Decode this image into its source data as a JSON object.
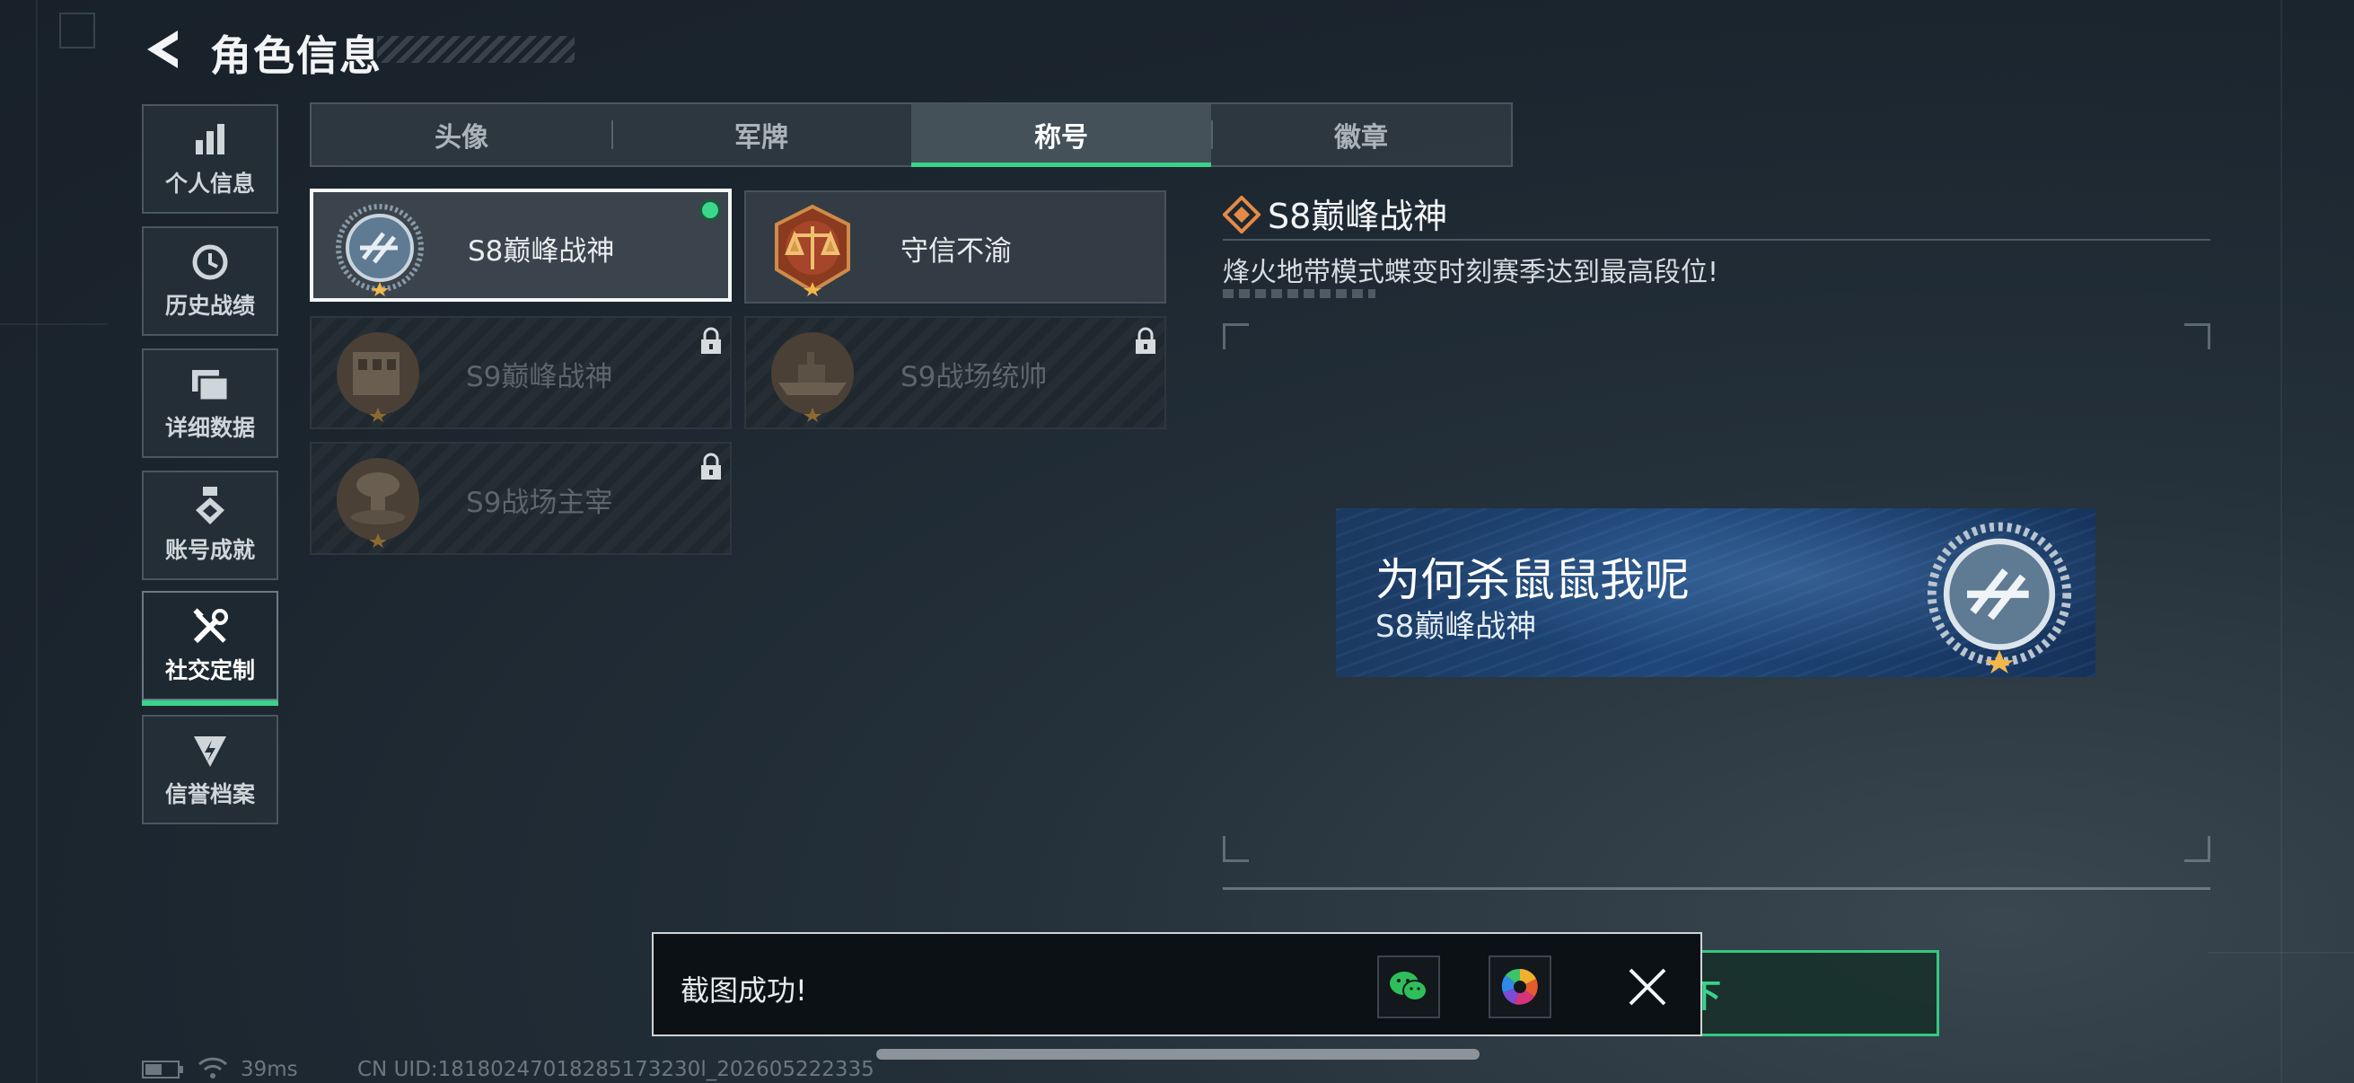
{
  "header": {
    "title": "角色信息"
  },
  "sidebar": {
    "items": [
      {
        "label": "个人信息",
        "icon": "bar-chart-icon"
      },
      {
        "label": "历史战绩",
        "icon": "clock-history-icon"
      },
      {
        "label": "详细数据",
        "icon": "folder-icon"
      },
      {
        "label": "账号成就",
        "icon": "medal-icon"
      },
      {
        "label": "社交定制",
        "icon": "tools-icon",
        "active": true
      },
      {
        "label": "信誉档案",
        "icon": "shield-bolt-icon"
      }
    ]
  },
  "tabs": [
    {
      "label": "头像"
    },
    {
      "label": "军牌"
    },
    {
      "label": "称号",
      "active": true
    },
    {
      "label": "徽章"
    }
  ],
  "titles": [
    {
      "name": "S8巅峰战神",
      "state": "equipped"
    },
    {
      "name": "守信不渝",
      "state": "owned"
    },
    {
      "name": "S9巅峰战神",
      "state": "locked"
    },
    {
      "name": "S9战场统帅",
      "state": "locked"
    },
    {
      "name": "S9战场主宰",
      "state": "locked"
    }
  ],
  "detail": {
    "title": "S8巅峰战神",
    "description": "烽火地带模式蝶变时刻赛季达到最高段位!"
  },
  "preview_banner": {
    "nickname": "为何杀鼠鼠我呢",
    "title": "S8巅峰战神"
  },
  "unequip_button": {
    "label": "卸下"
  },
  "toast": {
    "message": "截图成功!",
    "share_targets": [
      "wechat-icon",
      "photos-icon"
    ]
  },
  "status_bar": {
    "ping": "39ms",
    "uid": "CN UID:18180247018285173230l_202605222335"
  },
  "colors": {
    "accent": "#39d38b",
    "banner": "#1e4678"
  }
}
